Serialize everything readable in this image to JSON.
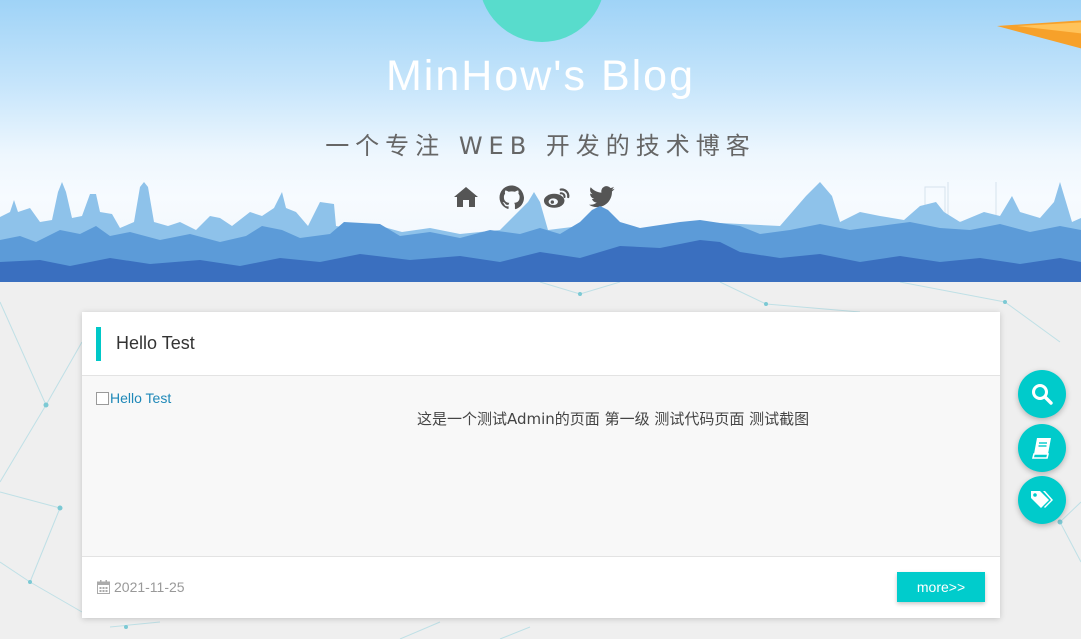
{
  "header": {
    "title": "MinHow's Blog",
    "subtitle": "一个专注 WEB 开发的技术博客",
    "social_icons": [
      "home-icon",
      "github-icon",
      "weibo-icon",
      "twitter-icon"
    ]
  },
  "post": {
    "title": "Hello Test",
    "image_alt": "Hello Test",
    "excerpt": "这是一个测试Admin的页面 第一级 测试代码页面 测试截图",
    "date": "2021-11-25",
    "more_label": "more>>"
  },
  "floating_buttons": [
    "search-icon",
    "book-icon",
    "tags-icon"
  ],
  "colors": {
    "accent": "#00cccc",
    "title_text": "#ffffff",
    "subtitle_text": "#666666",
    "header_top": "#9fd3f7",
    "circle": "#58dccc",
    "skyline": "#3d7ec9"
  }
}
